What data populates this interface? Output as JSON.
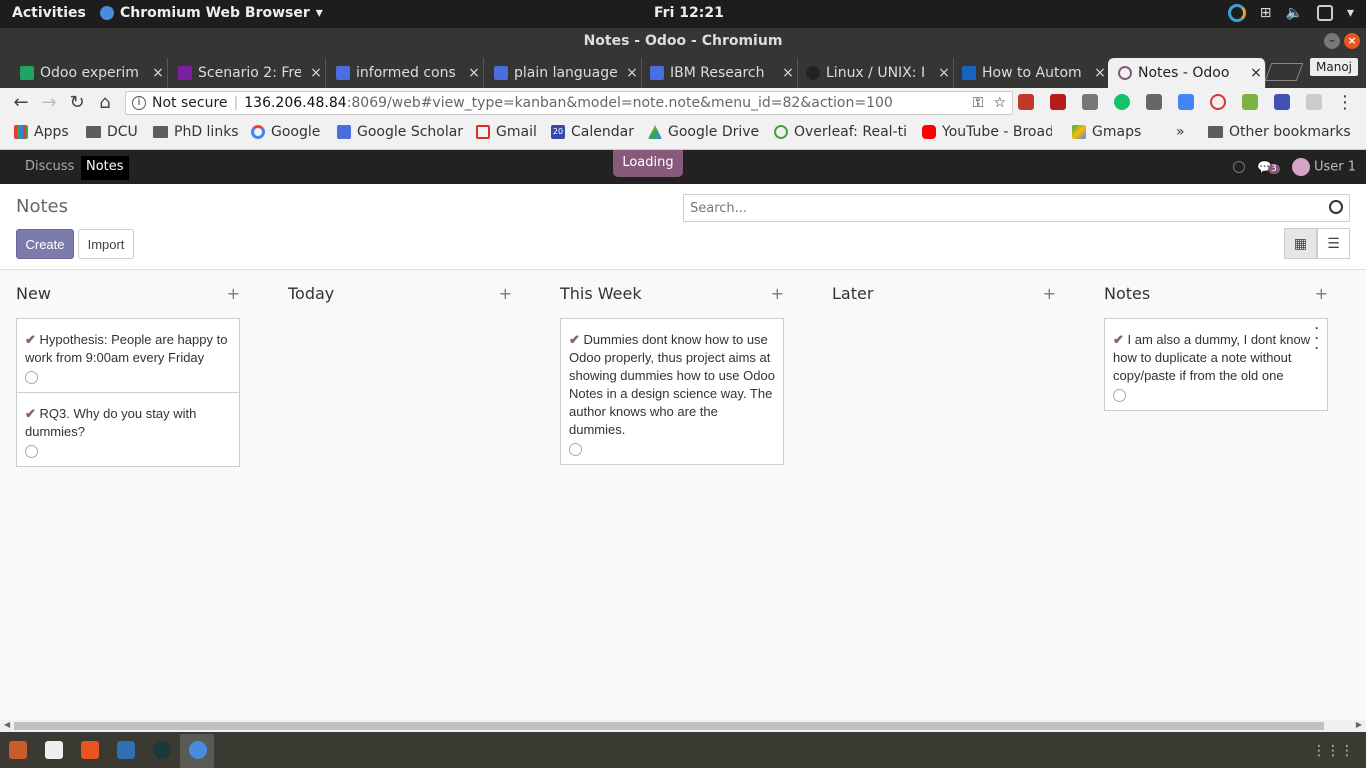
{
  "system": {
    "activities": "Activities",
    "app_name": "Chromium Web Browser",
    "clock": "Fri 12:21"
  },
  "window": {
    "title": "Notes - Odoo - Chromium"
  },
  "tabs": [
    {
      "label": "Odoo experim",
      "color": "#1fa463"
    },
    {
      "label": "Scenario 2: Fre",
      "color": "#7b1fa2"
    },
    {
      "label": "informed cons",
      "color": "#4a6ee0"
    },
    {
      "label": "plain language",
      "color": "#4a6ee0"
    },
    {
      "label": "IBM Research",
      "color": "#4a6ee0"
    },
    {
      "label": "Linux / UNIX: I",
      "color": "#222222"
    },
    {
      "label": "How to Autom",
      "color": "#1565c0"
    },
    {
      "label": "Notes - Odoo",
      "color": "#875a7b",
      "active": true
    }
  ],
  "profile": "Manoj",
  "omnibox": {
    "security": "Not secure",
    "host": "136.206.48.84",
    "path": ":8069/web#view_type=kanban&model=note.note&menu_id=82&action=100"
  },
  "bookmarks": [
    {
      "label": "Apps",
      "icon": "apps-grid-icon"
    },
    {
      "label": "DCU",
      "icon": "folder-icon"
    },
    {
      "label": "PhD links",
      "icon": "folder-icon"
    },
    {
      "label": "Google",
      "icon": "google-icon"
    },
    {
      "label": "Google Scholar",
      "icon": "scholar-icon"
    },
    {
      "label": "Gmail",
      "icon": "gmail-icon"
    },
    {
      "label": "Calendar",
      "icon": "calendar-icon"
    },
    {
      "label": "Google Drive",
      "icon": "drive-icon"
    },
    {
      "label": "Overleaf: Real-ti",
      "icon": "overleaf-icon"
    },
    {
      "label": "YouTube - Broad",
      "icon": "youtube-icon"
    },
    {
      "label": "Gmaps",
      "icon": "maps-icon"
    }
  ],
  "bookmarks_more": "»",
  "other_bookmarks": "Other bookmarks",
  "calendar_day": "20",
  "odoo_nav": {
    "discuss": "Discuss",
    "notes": "Notes",
    "loading": "Loading",
    "chat_count": "3",
    "user": "User 1"
  },
  "control": {
    "breadcrumb": "Notes",
    "create": "Create",
    "import": "Import",
    "search_placeholder": "Search..."
  },
  "columns": [
    {
      "title": "New",
      "cards": [
        {
          "text": "Hypothesis: People are happy to work from 9:00am every Friday"
        },
        {
          "text": "RQ3. Why do you stay with dummies?"
        }
      ]
    },
    {
      "title": "Today",
      "cards": []
    },
    {
      "title": "This Week",
      "cards": [
        {
          "text": "Dummies dont know how to use Odoo properly, thus project aims at showing dummies how to use Odoo Notes in a design science way. The author knows who are the dummies."
        }
      ]
    },
    {
      "title": "Later",
      "cards": []
    },
    {
      "title": "Notes",
      "cards": [
        {
          "text": "I am also a dummy, I dont know how to duplicate a note without copy/paste if from the old one"
        }
      ]
    }
  ],
  "colors": {
    "odoo_purple": "#875a7b",
    "create_button": "#7c7bad",
    "nav_bg": "#222222"
  }
}
